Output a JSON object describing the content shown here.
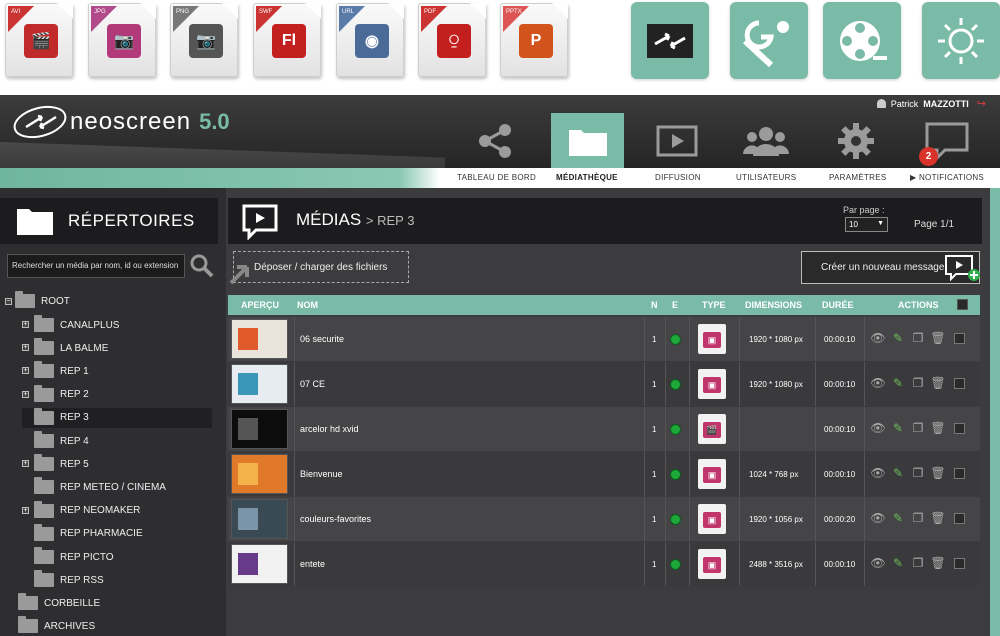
{
  "file_icons": [
    {
      "name": "avi-file-icon",
      "tag": "AVI",
      "tag_color": "#c33",
      "glyph": "🎬",
      "glyph_color": "#c12a2a"
    },
    {
      "name": "jpg-file-icon",
      "tag": "JPG",
      "tag_color": "#b04a8a",
      "glyph": "📷",
      "glyph_color": "#b23a7a"
    },
    {
      "name": "png-file-icon",
      "tag": "PNG",
      "tag_color": "#777",
      "glyph": "📷",
      "glyph_color": "#555"
    },
    {
      "name": "swf-file-icon",
      "tag": "SWF",
      "tag_color": "#c33",
      "glyph": "Fl",
      "glyph_color": "#c41f1f"
    },
    {
      "name": "url-file-icon",
      "tag": "URL",
      "tag_color": "#5a7aa8",
      "glyph": "◉",
      "glyph_color": "#4a6a98"
    },
    {
      "name": "pdf-file-icon",
      "tag": "PDF",
      "tag_color": "#c33",
      "glyph": "⍜",
      "glyph_color": "#c41f1f"
    },
    {
      "name": "pptx-file-icon",
      "tag": "PPTX",
      "tag_color": "#d55",
      "glyph": "P",
      "glyph_color": "#d2531c"
    }
  ],
  "app_icons": [
    "neoscreen-app-icon",
    "maps-app-icon",
    "film-reel-app-icon",
    "sun-app-icon"
  ],
  "brand": {
    "name": "neoscreen",
    "version": "5.0",
    "accent": "#79bba7"
  },
  "user": {
    "first": "Patrick",
    "last": "MAZZOTTI"
  },
  "nav": [
    {
      "label": "TABLEAU DE BORD",
      "icon": "share-icon",
      "active": false
    },
    {
      "label": "MÉDIATHÈQUE",
      "icon": "folder-icon",
      "active": true
    },
    {
      "label": "DIFFUSION",
      "icon": "play-screen-icon",
      "active": false
    },
    {
      "label": "UTILISATEURS",
      "icon": "users-icon",
      "active": false
    },
    {
      "label": "PARAMÈTRES",
      "icon": "gear-icon",
      "active": false
    },
    {
      "label": "▶ NOTIFICATIONS",
      "icon": "chat-bubble-icon",
      "active": false,
      "badge": "2"
    }
  ],
  "sidebar": {
    "title": "RÉPERTOIRES",
    "search_placeholder": "Rechercher un média par nom, id ou extension",
    "root": "ROOT",
    "items": [
      {
        "label": "CANALPLUS",
        "plus": true
      },
      {
        "label": "LA BALME",
        "plus": true
      },
      {
        "label": "REP 1",
        "plus": true
      },
      {
        "label": "REP 2",
        "plus": true
      },
      {
        "label": "REP 3",
        "plus": false,
        "selected": true
      },
      {
        "label": "REP 4",
        "plus": false
      },
      {
        "label": "REP 5",
        "plus": true
      },
      {
        "label": "REP METEO / CINEMA",
        "plus": false
      },
      {
        "label": "REP NEOMAKER",
        "plus": true
      },
      {
        "label": "REP PHARMACIE",
        "plus": false
      },
      {
        "label": "REP PICTO",
        "plus": false
      },
      {
        "label": "REP RSS",
        "plus": false
      }
    ],
    "trash": "CORBEILLE",
    "archives": "ARCHIVES"
  },
  "main": {
    "title": "MÉDIAS",
    "breadcrumb": "> REP 3",
    "per_page_label": "Par page :",
    "per_page_value": "10",
    "page_info": "Page 1/1",
    "upload_label": "Déposer / charger des fichiers",
    "new_message_label": "Créer un nouveau message"
  },
  "table": {
    "headers": {
      "preview": "APERÇU",
      "name": "NOM",
      "n": "N",
      "e": "E",
      "type": "TYPE",
      "dimensions": "DIMENSIONS",
      "duration": "DURÉE",
      "actions": "ACTIONS"
    },
    "rows": [
      {
        "name": "06 securite",
        "n": "1",
        "type": "image",
        "dimensions": "1920 * 1080 px",
        "duration": "00:00:10",
        "thumb": "#e9e4dc",
        "thumb_accent": "#e05a2a"
      },
      {
        "name": "07 CE",
        "n": "1",
        "type": "image",
        "dimensions": "1920 * 1080 px",
        "duration": "00:00:10",
        "thumb": "#e6ecef",
        "thumb_accent": "#3c96b8"
      },
      {
        "name": "arcelor hd xvid",
        "n": "1",
        "type": "video",
        "dimensions": "",
        "duration": "00:00:10",
        "thumb": "#0c0c0c",
        "thumb_accent": "#555"
      },
      {
        "name": "Bienvenue",
        "n": "1",
        "type": "image",
        "dimensions": "1024 * 768 px",
        "duration": "00:00:10",
        "thumb": "#e07a2a",
        "thumb_accent": "#f3b24a"
      },
      {
        "name": "couleurs-favorites",
        "n": "1",
        "type": "image",
        "dimensions": "1920 * 1056 px",
        "duration": "00:00:20",
        "thumb": "#3a4a55",
        "thumb_accent": "#7a95a8"
      },
      {
        "name": "entete",
        "n": "1",
        "type": "image",
        "dimensions": "2488 * 3516 px",
        "duration": "00:00:10",
        "thumb": "#f2f2f2",
        "thumb_accent": "#6a3a8a"
      }
    ]
  }
}
